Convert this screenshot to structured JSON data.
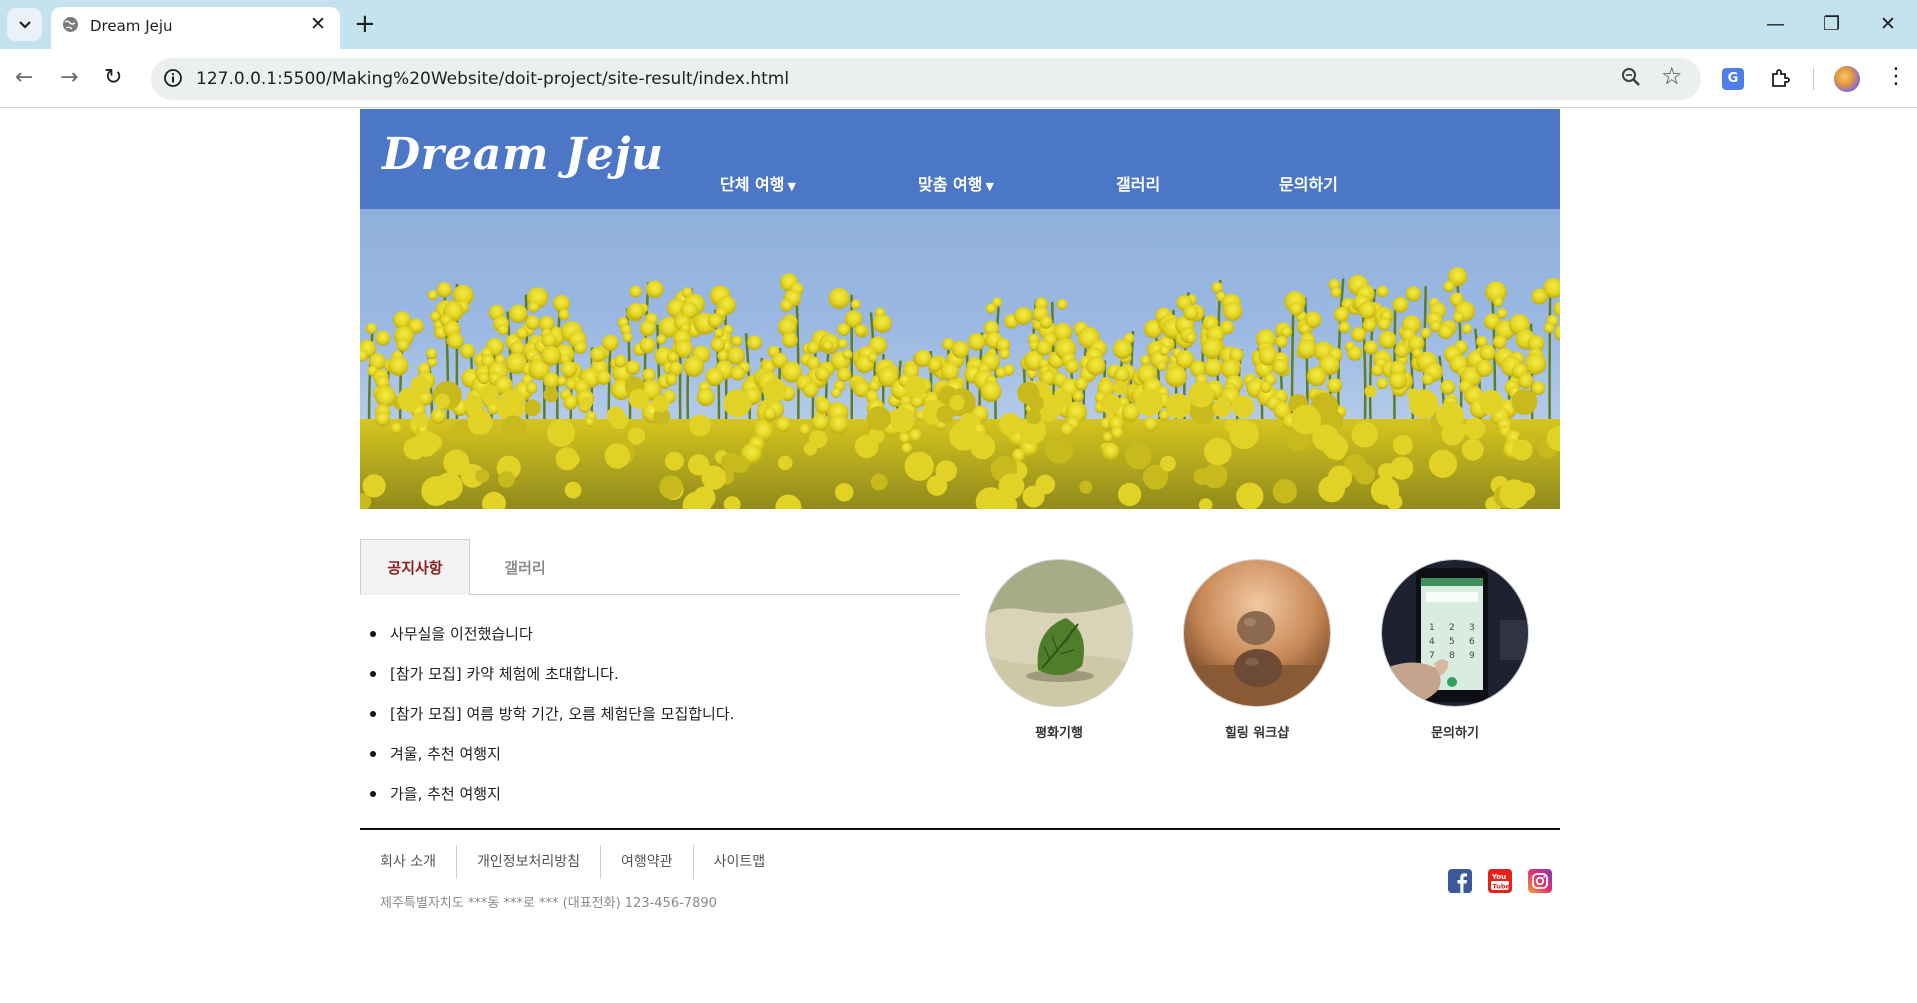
{
  "browser": {
    "tab_title": "Dream Jeju",
    "url": "127.0.0.1:5500/Making%20Website/doit-project/site-result/index.html"
  },
  "header": {
    "logo": "Dream Jeju",
    "nav": [
      {
        "label": "단체 여행",
        "has_dropdown": true
      },
      {
        "label": "맞춤 여행",
        "has_dropdown": true
      },
      {
        "label": "갤러리",
        "has_dropdown": false
      },
      {
        "label": "문의하기",
        "has_dropdown": false
      }
    ],
    "dropdown_caret": "▼"
  },
  "hero": {
    "image": "yellow-canola-flowers-under-blue-sky"
  },
  "tabs": [
    {
      "label": "공지사항",
      "active": true
    },
    {
      "label": "갤러리",
      "active": false
    }
  ],
  "notices": [
    "사무실을 이전했습니다",
    "[참가 모집] 카약 체험에 초대합니다.",
    "[참가 모집] 여름 방학 기간, 오름 체험단을 모집합니다.",
    "겨울, 추천 여행지",
    "가을, 추천 여행지"
  ],
  "cards": [
    {
      "label": "평화기행",
      "image": "leaf-on-sand"
    },
    {
      "label": "힐링 워크샵",
      "image": "stacked-stones"
    },
    {
      "label": "문의하기",
      "image": "phone-dialpad"
    }
  ],
  "footer": {
    "links": [
      "회사 소개",
      "개인정보처리방침",
      "여행약관",
      "사이트맵"
    ],
    "address": "제주특별자치도 ***동 ***로 *** (대표전화) 123-456-7890",
    "social": [
      "facebook-icon",
      "youtube-icon",
      "instagram-icon"
    ]
  },
  "colors": {
    "header_bg": "#4b77c6",
    "active_tab_text": "#8a2020",
    "browser_tabstrip": "#c5e3ee"
  }
}
